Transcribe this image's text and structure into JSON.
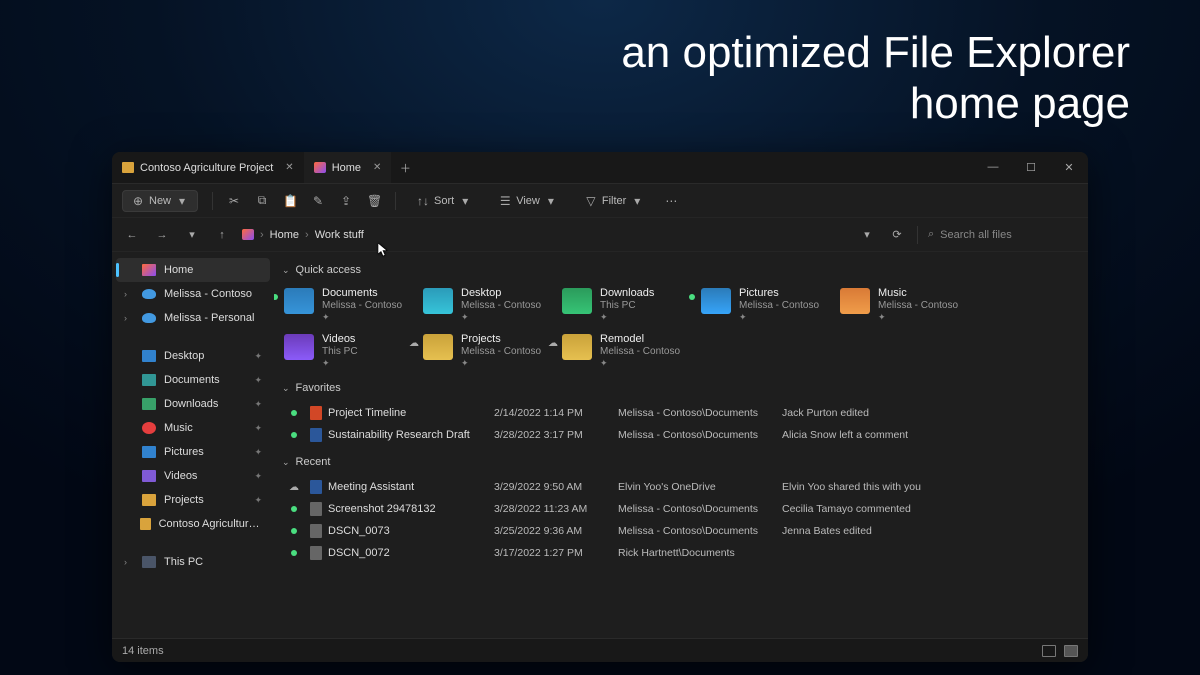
{
  "headline": {
    "line1": "an optimized File Explorer",
    "line2": "home page"
  },
  "tabs": [
    {
      "label": "Contoso Agriculture Project",
      "icon": "folder"
    },
    {
      "label": "Home",
      "icon": "home"
    }
  ],
  "toolbar": {
    "new_label": "New",
    "sort_label": "Sort",
    "view_label": "View",
    "filter_label": "Filter"
  },
  "breadcrumb": {
    "seg1": "Home",
    "seg2": "Work stuff"
  },
  "search": {
    "placeholder": "Search all files"
  },
  "sidebar": {
    "home": "Home",
    "acct1": "Melissa - Contoso",
    "acct2": "Melissa - Personal",
    "items": [
      {
        "label": "Desktop"
      },
      {
        "label": "Documents"
      },
      {
        "label": "Downloads"
      },
      {
        "label": "Music"
      },
      {
        "label": "Pictures"
      },
      {
        "label": "Videos"
      },
      {
        "label": "Projects"
      },
      {
        "label": "Contoso Agriculture Project"
      }
    ],
    "pc": "This PC"
  },
  "sections": {
    "quick_access": "Quick access",
    "favorites": "Favorites",
    "recent": "Recent"
  },
  "quick_access": [
    {
      "name": "Documents",
      "loc": "Melissa - Contoso",
      "ico": "docs",
      "status": "dot"
    },
    {
      "name": "Desktop",
      "loc": "Melissa - Contoso",
      "ico": "desk",
      "status": ""
    },
    {
      "name": "Downloads",
      "loc": "This PC",
      "ico": "down",
      "status": ""
    },
    {
      "name": "Pictures",
      "loc": "Melissa - Contoso",
      "ico": "pics",
      "status": "dot"
    },
    {
      "name": "Music",
      "loc": "Melissa - Contoso",
      "ico": "music",
      "status": ""
    },
    {
      "name": "Videos",
      "loc": "This PC",
      "ico": "vids",
      "status": ""
    },
    {
      "name": "Projects",
      "loc": "Melissa - Contoso",
      "ico": "proj",
      "status": "cloud"
    },
    {
      "name": "Remodel",
      "loc": "Melissa - Contoso",
      "ico": "remo",
      "status": "cloud"
    }
  ],
  "favorites": [
    {
      "name": "Project Timeline",
      "date": "2/14/2022 1:14 PM",
      "loc": "Melissa - Contoso\\Documents",
      "act": "Jack Purton edited",
      "ico": "pp"
    },
    {
      "name": "Sustainability Research Draft",
      "date": "3/28/2022 3:17 PM",
      "loc": "Melissa - Contoso\\Documents",
      "act": "Alicia Snow left a comment",
      "ico": "wd"
    }
  ],
  "recent": [
    {
      "name": "Meeting Assistant",
      "date": "3/29/2022 9:50 AM",
      "loc": "Elvin Yoo's OneDrive",
      "act": "Elvin Yoo shared this with you",
      "ico": "wd",
      "status": "cloud"
    },
    {
      "name": "Screenshot 29478132",
      "date": "3/28/2022 11:23 AM",
      "loc": "Melissa - Contoso\\Documents",
      "act": "Cecilia Tamayo commented",
      "ico": "im",
      "status": "dot"
    },
    {
      "name": "DSCN_0073",
      "date": "3/25/2022 9:36 AM",
      "loc": "Melissa - Contoso\\Documents",
      "act": "Jenna Bates edited",
      "ico": "im",
      "status": "dot"
    },
    {
      "name": "DSCN_0072",
      "date": "3/17/2022 1:27 PM",
      "loc": "Rick Hartnett\\Documents",
      "act": "",
      "ico": "im",
      "status": "dot"
    }
  ],
  "status": {
    "count": "14 items"
  }
}
